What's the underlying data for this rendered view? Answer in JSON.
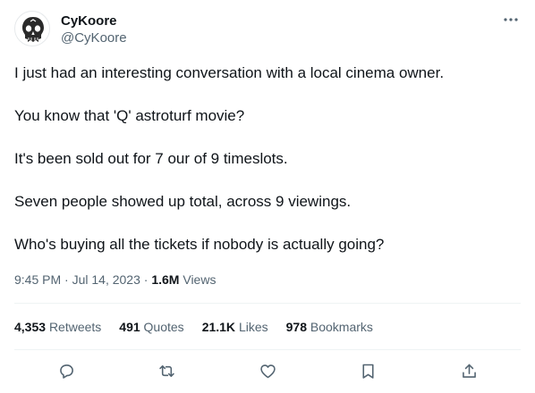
{
  "author": {
    "display_name": "CyKoore",
    "handle": "@CyKoore",
    "avatar_icon": "skull-icon"
  },
  "tweet": {
    "paragraphs": [
      "I just had an interesting conversation with a local cinema owner.",
      "You know that 'Q' astroturf movie?",
      "It's been sold out for 7 our of 9 timeslots.",
      "Seven people showed up total, across 9 viewings.",
      "Who's buying all the tickets if nobody is actually going?"
    ],
    "time": "9:45 PM",
    "separator": " · ",
    "date": "Jul 14, 2023",
    "views_count": "1.6M",
    "views_label": "Views"
  },
  "stats": {
    "retweets_count": "4,353",
    "retweets_label": "Retweets",
    "quotes_count": "491",
    "quotes_label": "Quotes",
    "likes_count": "21.1K",
    "likes_label": "Likes",
    "bookmarks_count": "978",
    "bookmarks_label": "Bookmarks"
  },
  "actions": [
    "reply-icon",
    "retweet-icon",
    "like-icon",
    "bookmark-icon",
    "share-icon"
  ],
  "colors": {
    "text_primary": "#0f1419",
    "text_secondary": "#536471",
    "divider": "#eff3f4"
  }
}
